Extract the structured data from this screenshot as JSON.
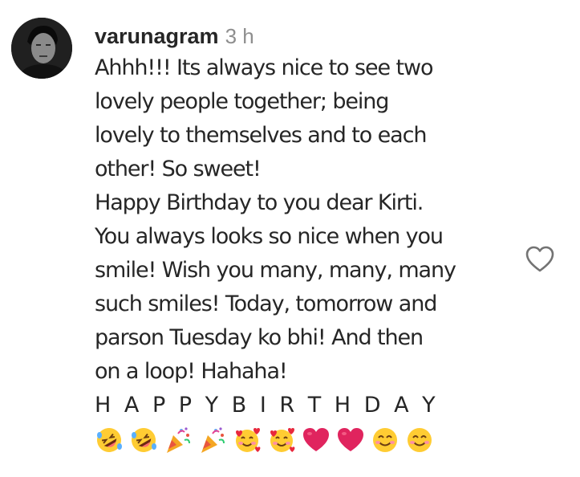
{
  "comment": {
    "username": "varunagram",
    "timestamp": "3 h",
    "lines": [
      "Ahhh!!! Its always nice to see two",
      "lovely people together; being",
      "lovely to themselves and to each",
      "other! So sweet!",
      "Happy Birthday to you dear Kirti.",
      "You always looks so nice when you",
      "smile! Wish you many, many, many",
      "such smiles! Today, tomorrow and",
      "parson Tuesday ko bhi! And then",
      "on a loop! Hahaha!"
    ],
    "spaced_line": "H A P P Y B I R T H D A Y",
    "emojis": [
      "rolling-laughing-emoji",
      "rolling-laughing-emoji",
      "party-popper-emoji",
      "party-popper-emoji",
      "smiling-face-with-hearts-emoji",
      "smiling-face-with-hearts-emoji",
      "red-heart-emoji",
      "red-heart-emoji",
      "smiling-face-emoji",
      "smiling-face-emoji"
    ]
  },
  "icons": {
    "like": "heart-outline-icon",
    "avatar": "profile-photo"
  },
  "colors": {
    "text": "#262626",
    "secondary": "#8e8e8e",
    "heart": "#e0245e",
    "emoji_face": "#ffcc33"
  }
}
